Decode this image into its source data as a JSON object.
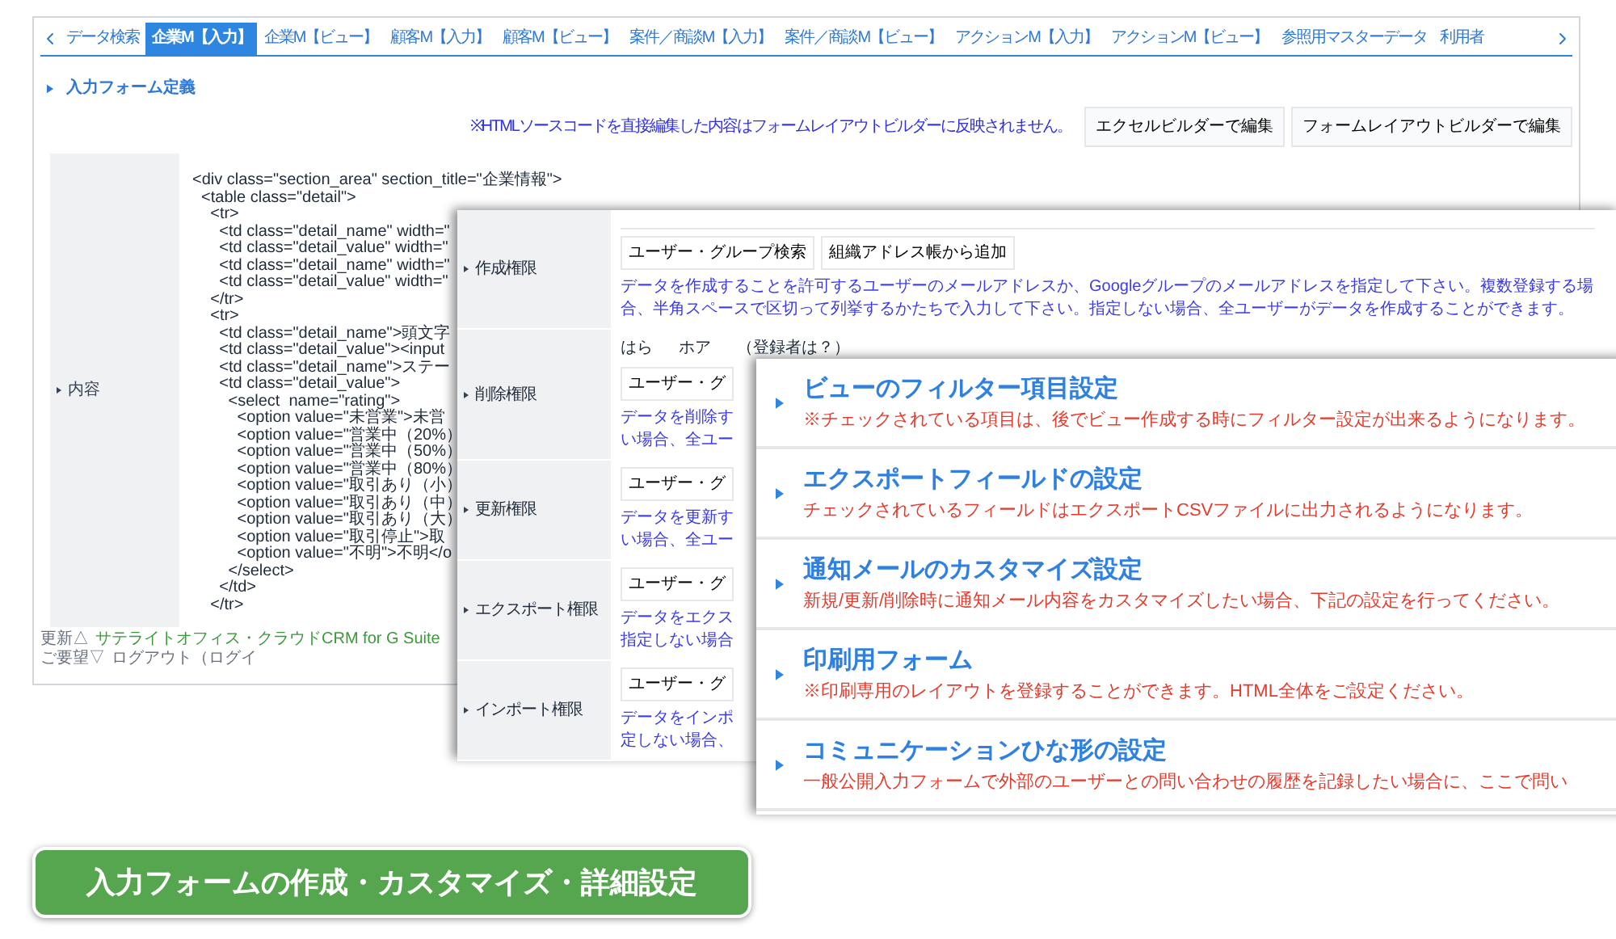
{
  "back_window": {
    "tabs": [
      {
        "label": "データ検索",
        "selected": false
      },
      {
        "label": "企業M【入力】",
        "selected": true
      },
      {
        "label": "企業M【ビュー】",
        "selected": false
      },
      {
        "label": "顧客M【入力】",
        "selected": false
      },
      {
        "label": "顧客M【ビュー】",
        "selected": false
      },
      {
        "label": "案件／商談M【入力】",
        "selected": false
      },
      {
        "label": "案件／商談M【ビュー】",
        "selected": false
      },
      {
        "label": "アクションM【入力】",
        "selected": false
      },
      {
        "label": "アクションM【ビュー】",
        "selected": false
      },
      {
        "label": "参照用マスターデータ",
        "selected": false
      },
      {
        "label": "利用者",
        "selected": false
      }
    ],
    "section_title": "入力フォーム定義",
    "note": "※HTMLソースコードを直接編集した内容はフォームレイアウトビルダーに反映されません。",
    "buttons": [
      "エクセルビルダーで編集",
      "フォームレイアウトビルダーで編集"
    ],
    "field_label": "内容",
    "code_lines": [
      "<div class=\"section_area\" section_title=\"企業情報\">",
      "  <table class=\"detail\">",
      "    <tr>",
      "      <td class=\"detail_name\" width=\"",
      "      <td class=\"detail_value\" width=\"",
      "      <td class=\"detail_name\" width=\"",
      "      <td class=\"detail_value\" width=\"",
      "    </tr>",
      "    <tr>",
      "      <td class=\"detail_name\">頭文字",
      "      <td class=\"detail_value\"><input",
      "      <td class=\"detail_name\">ステー",
      "      <td class=\"detail_value\">",
      "        <select  name=\"rating\">",
      "          <option value=\"未営業\">未営",
      "          <option value=\"営業中（20%）",
      "          <option value=\"営業中（50%）",
      "          <option value=\"営業中（80%）",
      "          <option value=\"取引あり（小）",
      "          <option value=\"取引あり（中）",
      "          <option value=\"取引あり（大）",
      "          <option value=\"取引停止\">取",
      "          <option value=\"不明\">不明</o",
      "        </select>",
      "      </td>",
      "    </tr>"
    ],
    "footer": {
      "update": "更新△",
      "app_link": "サテライトオフィス・クラウドCRM for G Suite",
      "feedback": "ご要望▽",
      "logout": "ログアウト（ログイ"
    }
  },
  "permissions_window": {
    "rows": [
      {
        "label": "作成権限",
        "buttons": [
          "ユーザー・グループ検索",
          "組織アドレス帳から追加"
        ],
        "description_lines": [
          "データを作成することを許可するユーザーのメールアドレスか、Googleグループのメールアドレスを指定して下さい。複数登録する場合、半角スペースで区切って列挙するかたちで入力して下さい。指定しない場合、全ユーザーがデータを作成することができます。"
        ]
      },
      {
        "label": "削除権限",
        "members": [
          "はら",
          "ホア",
          "（登録者は？）"
        ],
        "buttons": [
          "ユーザー・グ"
        ],
        "description_lines": [
          "データを削除す",
          "い場合、全ユー"
        ]
      },
      {
        "label": "更新権限",
        "buttons": [
          "ユーザー・グ"
        ],
        "description_lines": [
          "データを更新す",
          "い場合、全ユー"
        ]
      },
      {
        "label": "エクスポート権限",
        "buttons": [
          "ユーザー・グ"
        ],
        "description_lines": [
          "データをエクス",
          "指定しない場合"
        ]
      },
      {
        "label": "インポート権限",
        "buttons": [
          "ユーザー・グ"
        ],
        "description_lines": [
          "データをインポ",
          "定しない場合、"
        ]
      }
    ]
  },
  "settings_window": {
    "items": [
      {
        "title": "ビューのフィルター項目設定",
        "description": "※チェックされている項目は、後でビュー作成する時にフィルター設定が出来るようになります。"
      },
      {
        "title": "エクスポートフィールドの設定",
        "description": "チェックされているフィールドはエクスポートCSVファイルに出力されるようになります。"
      },
      {
        "title": "通知メールのカスタマイズ設定",
        "description": "新規/更新/削除時に通知メール内容をカスタマイズしたい場合、下記の設定を行ってください。"
      },
      {
        "title": "印刷用フォーム",
        "description": "※印刷専用のレイアウトを登録することができます。HTML全体をご設定ください。"
      },
      {
        "title": "コミュニケーションひな形の設定",
        "description": "一般公開入力フォームで外部のユーザーとの問い合わせの履歴を記録したい場合に、ここで問い"
      }
    ]
  },
  "caption": "入力フォームの作成・カスタマイズ・詳細設定"
}
